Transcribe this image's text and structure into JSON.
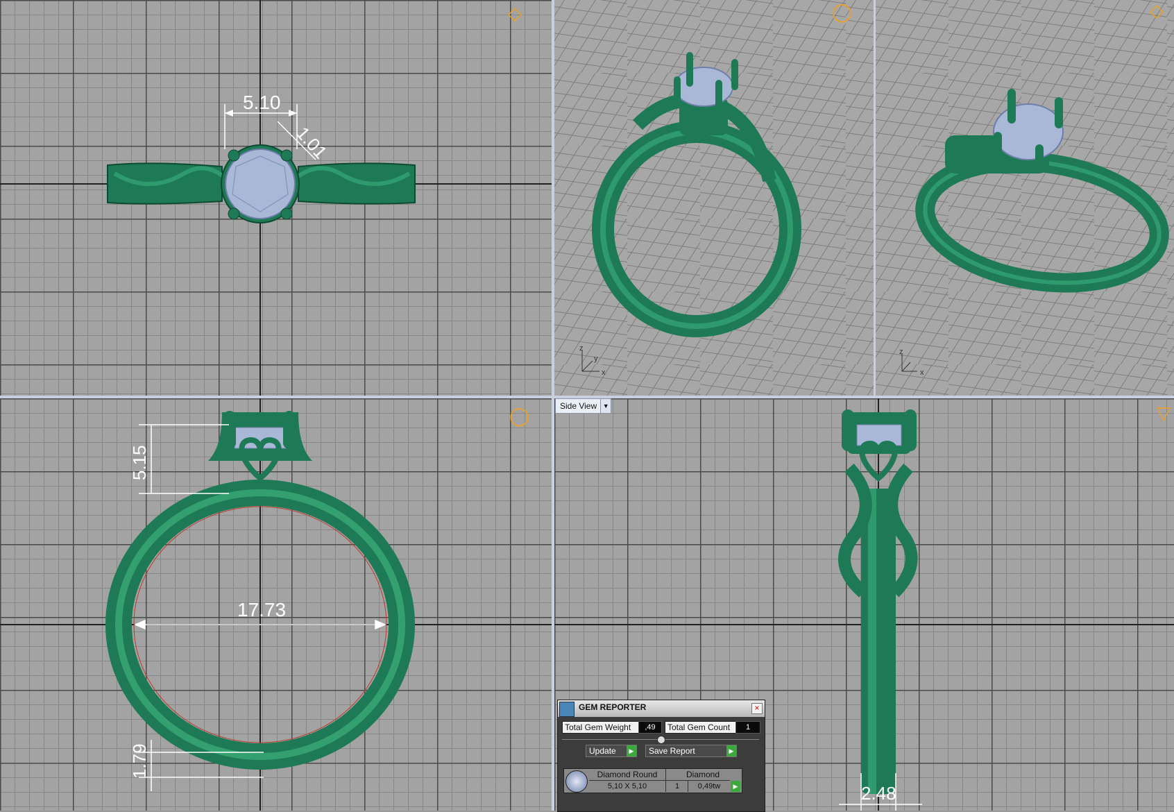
{
  "viewports": {
    "top": {
      "dim_width": "5.10",
      "dim_prong": "1.01"
    },
    "front": {
      "dim_height": "5.15",
      "dim_inner": "17.73",
      "dim_shank": "1.79"
    },
    "side": {
      "view_label": "Side View",
      "dim_width": "2.48"
    }
  },
  "axis": {
    "x": "x",
    "y": "y",
    "z": "z"
  },
  "gem_reporter": {
    "title": "GEM REPORTER",
    "close": "×",
    "total_weight_label": "Total Gem Weight",
    "total_weight_value": ",49",
    "total_count_label": "Total Gem Count",
    "total_count_value": "1",
    "update_label": "Update",
    "save_label": "Save Report",
    "go": "▶",
    "row": {
      "name": "Diamond Round",
      "material": "Diamond",
      "size": "5,10 X 5,10",
      "count": "1",
      "weight": "0,49tw"
    }
  },
  "icons": {
    "top": "diamond-icon",
    "front": "ring-icon",
    "side": "ring-side-icon"
  },
  "colors": {
    "metal": "#1e7a56",
    "gem": "#aab8d8",
    "dim": "#ffffff",
    "icon": "#f0a020"
  }
}
